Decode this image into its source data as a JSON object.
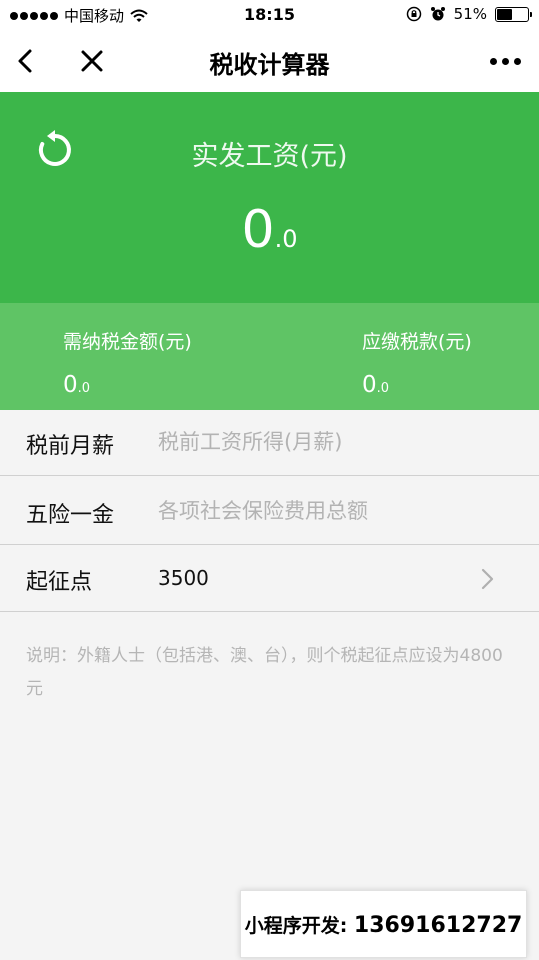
{
  "status_bar": {
    "carrier": "中国移动",
    "time": "18:15",
    "battery_percent": "51%",
    "battery_level": 0.51,
    "signal_dots": 5
  },
  "nav": {
    "title": "税收计算器",
    "back_icon": "chevron-left-icon",
    "close_icon": "close-icon",
    "more_icon": "more-icon"
  },
  "result": {
    "label": "实发工资(元)",
    "value_int": "0",
    "value_dec": ".0",
    "reset_icon": "refresh-icon",
    "color": "#3cb64a"
  },
  "taxable": {
    "label": "需纳税金额(元)",
    "value_int": "0",
    "value_dec": ".0"
  },
  "tax_due": {
    "label": "应缴税款(元)",
    "value_int": "0",
    "value_dec": ".0"
  },
  "form": {
    "salary": {
      "label": "税前月薪",
      "value": "",
      "placeholder": "税前工资所得(月薪)"
    },
    "insurance": {
      "label": "五险一金",
      "value": "",
      "placeholder": "各项社会保险费用总额"
    },
    "threshold": {
      "label": "起征点",
      "value": "3500"
    }
  },
  "note": "说明：外籍人士（包括港、澳、台），则个税起征点应设为4800元",
  "ad": {
    "label": "小程序开发:",
    "phone": "13691612727"
  }
}
